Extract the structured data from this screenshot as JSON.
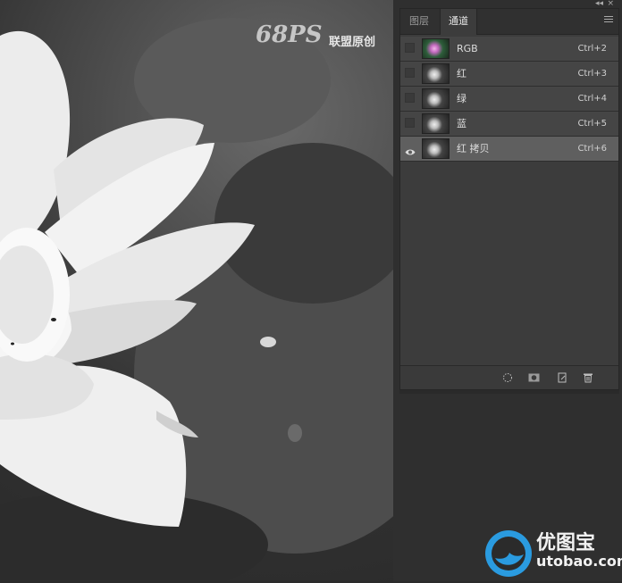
{
  "watermark": {
    "brand": "68PS",
    "text": "联盟原创"
  },
  "panel": {
    "tabs": [
      {
        "label": "图层",
        "active": false
      },
      {
        "label": "通道",
        "active": true
      }
    ],
    "channels": [
      {
        "name": "RGB",
        "shortcut": "Ctrl+2",
        "visible": false,
        "selected": false,
        "thumb": "color"
      },
      {
        "name": "红",
        "shortcut": "Ctrl+3",
        "visible": false,
        "selected": false,
        "thumb": "gray"
      },
      {
        "name": "绿",
        "shortcut": "Ctrl+4",
        "visible": false,
        "selected": false,
        "thumb": "gray"
      },
      {
        "name": "蓝",
        "shortcut": "Ctrl+5",
        "visible": false,
        "selected": false,
        "thumb": "gray"
      },
      {
        "name": "红 拷贝",
        "shortcut": "Ctrl+6",
        "visible": true,
        "selected": true,
        "thumb": "gray"
      }
    ],
    "footer_icons": [
      "load-selection-icon",
      "save-selection-icon",
      "new-channel-icon",
      "delete-channel-icon"
    ]
  },
  "logo": {
    "name": "优图宝",
    "url": "utobao.com"
  },
  "colors": {
    "panel_bg": "#3c3c3c",
    "row_bg": "#454545",
    "row_selected": "#5f5f5f",
    "logo_blue": "#2a9be0"
  }
}
